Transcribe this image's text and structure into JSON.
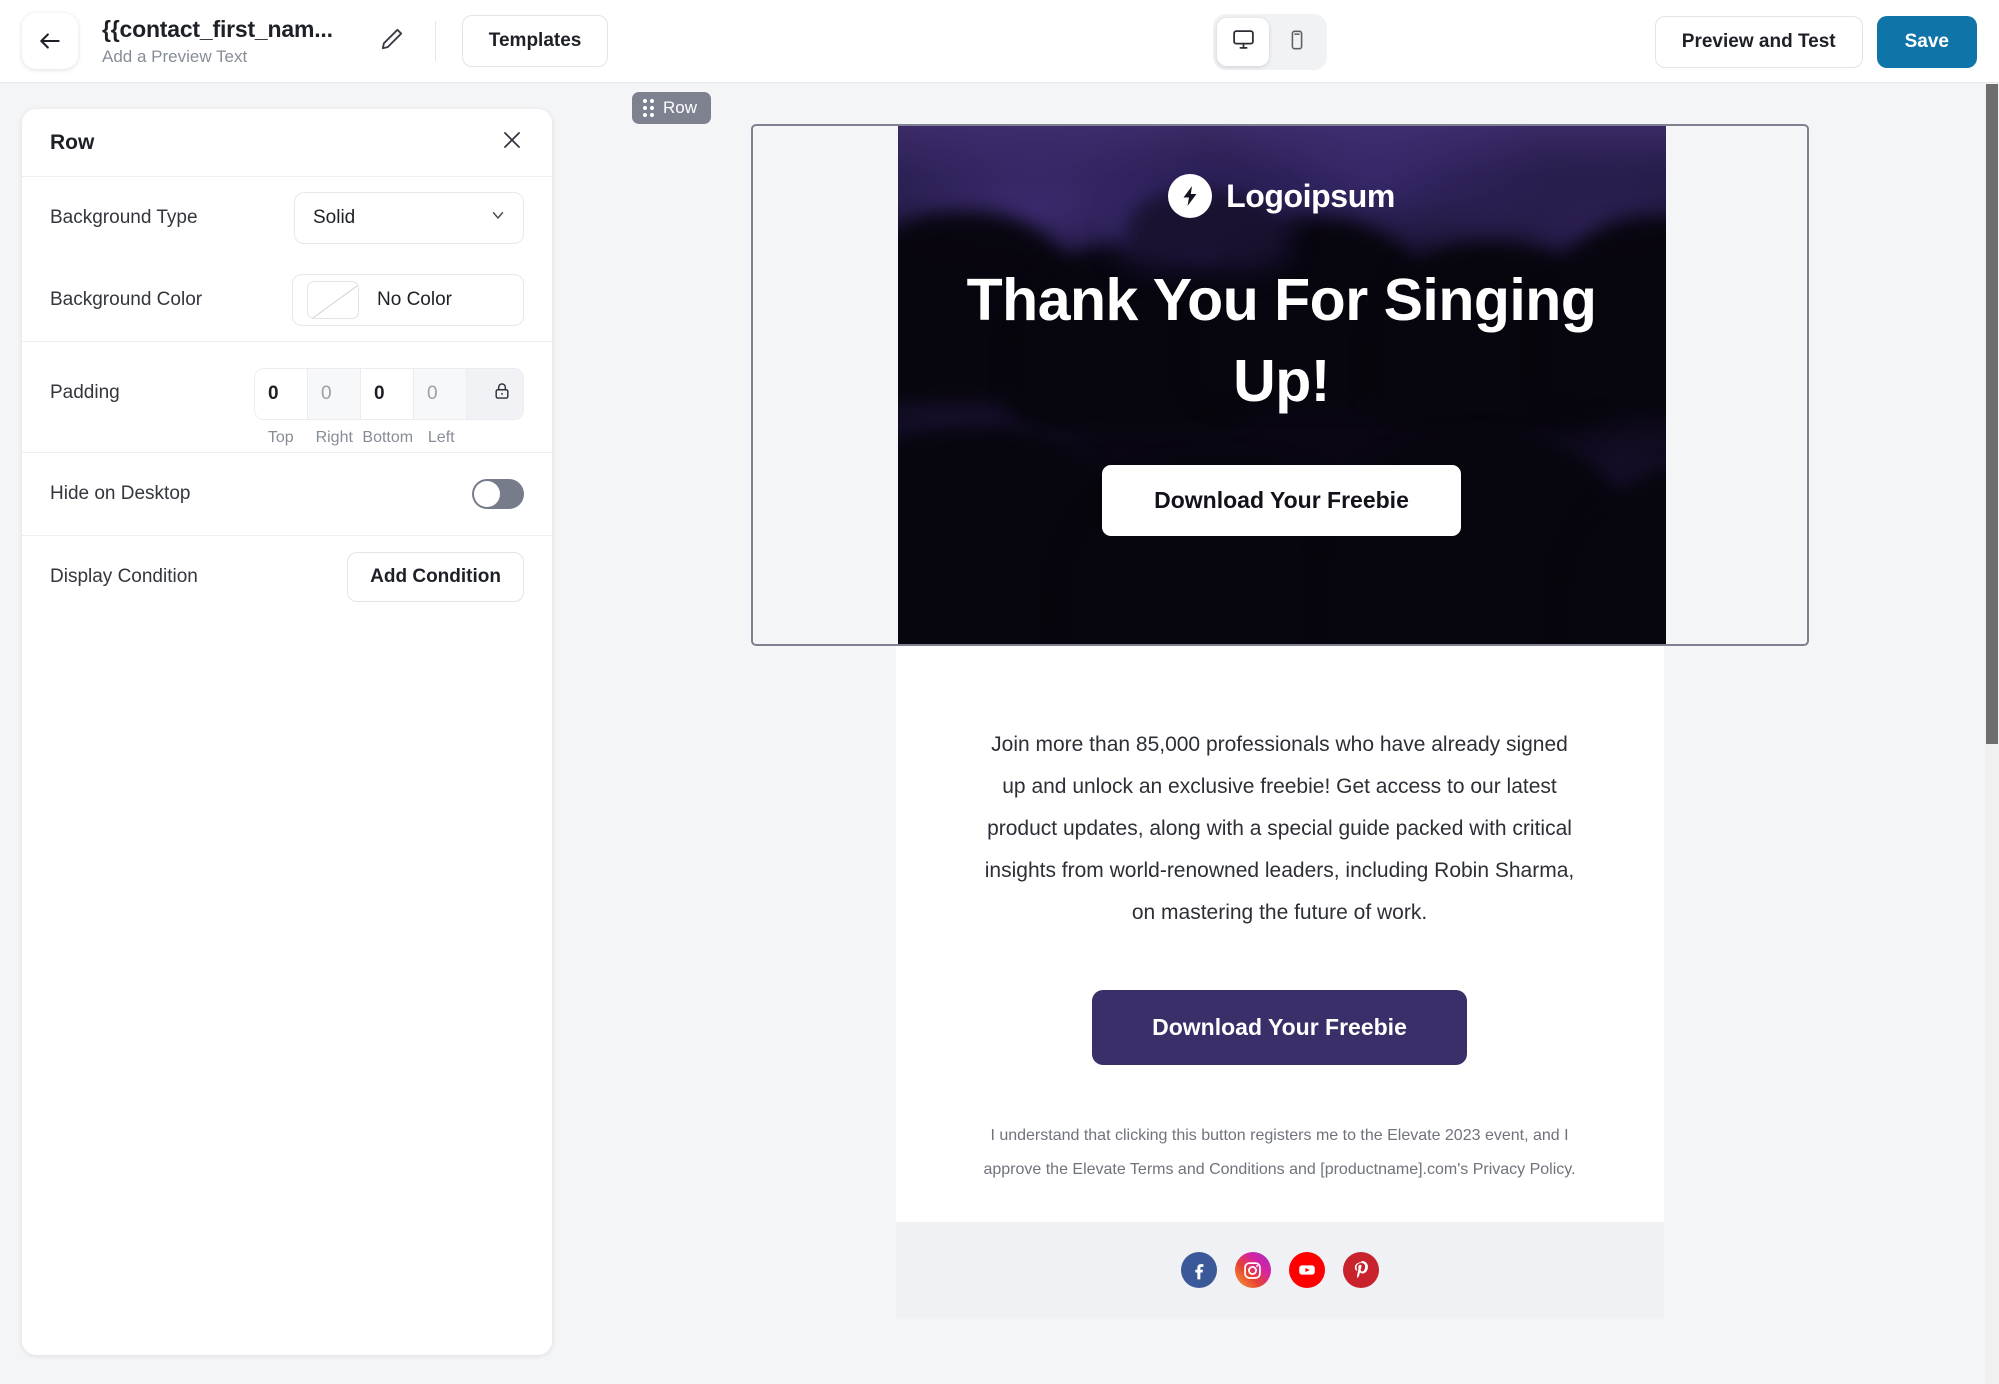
{
  "topbar": {
    "back_icon": "arrow-left-icon",
    "email_title": "{{contact_first_nam...",
    "preview_text_placeholder": "Add a Preview Text",
    "edit_icon": "pencil-icon",
    "templates_label": "Templates",
    "desktop_icon": "monitor-icon",
    "mobile_icon": "phone-icon",
    "preview_label": "Preview and Test",
    "save_label": "Save",
    "save_color": "#0f74a8"
  },
  "panel": {
    "title": "Row",
    "close_icon": "close-icon",
    "background_type": {
      "label": "Background Type",
      "value": "Solid",
      "chevron_icon": "chevron-down-icon"
    },
    "background_color": {
      "label": "Background Color",
      "value": "No Color",
      "swatch_icon": "no-color-swatch-icon"
    },
    "padding": {
      "label": "Padding",
      "top": "0",
      "right": "0",
      "bottom": "0",
      "left": "0",
      "caption_top": "Top",
      "caption_right": "Right",
      "caption_bottom": "Bottom",
      "caption_left": "Left",
      "lock_icon": "lock-icon"
    },
    "hide_on_desktop": {
      "label": "Hide on Desktop",
      "enabled": false
    },
    "display_condition": {
      "label": "Display Condition",
      "button_label": "Add Condition"
    }
  },
  "canvas": {
    "row_badge": {
      "label": "Row",
      "drag_icon": "drag-handle-icon"
    },
    "hero": {
      "logo_text": "Logoipsum",
      "logo_icon": "bolt-icon",
      "heading": "Thank You For Singing Up!",
      "cta_label": "Download Your Freebie"
    },
    "body": {
      "paragraph": "Join more than 85,000 professionals who have already signed up and unlock an exclusive freebie! Get access to our latest product updates, along with a special guide packed with critical insights from world-renowned leaders, including Robin Sharma, on mastering the future of work.",
      "cta_label": "Download Your Freebie",
      "cta_color": "#3a2f68",
      "disclaimer": "I understand that clicking this button registers me to the Elevate 2023 event, and I approve the Elevate Terms and Conditions and [productname].com's Privacy Policy."
    },
    "footer": {
      "social": [
        {
          "name": "facebook-icon",
          "color": "#3b5998"
        },
        {
          "name": "instagram-icon",
          "color": "#d6249f"
        },
        {
          "name": "youtube-icon",
          "color": "#ff0000"
        },
        {
          "name": "pinterest-icon",
          "color": "#c8232c"
        }
      ]
    }
  }
}
